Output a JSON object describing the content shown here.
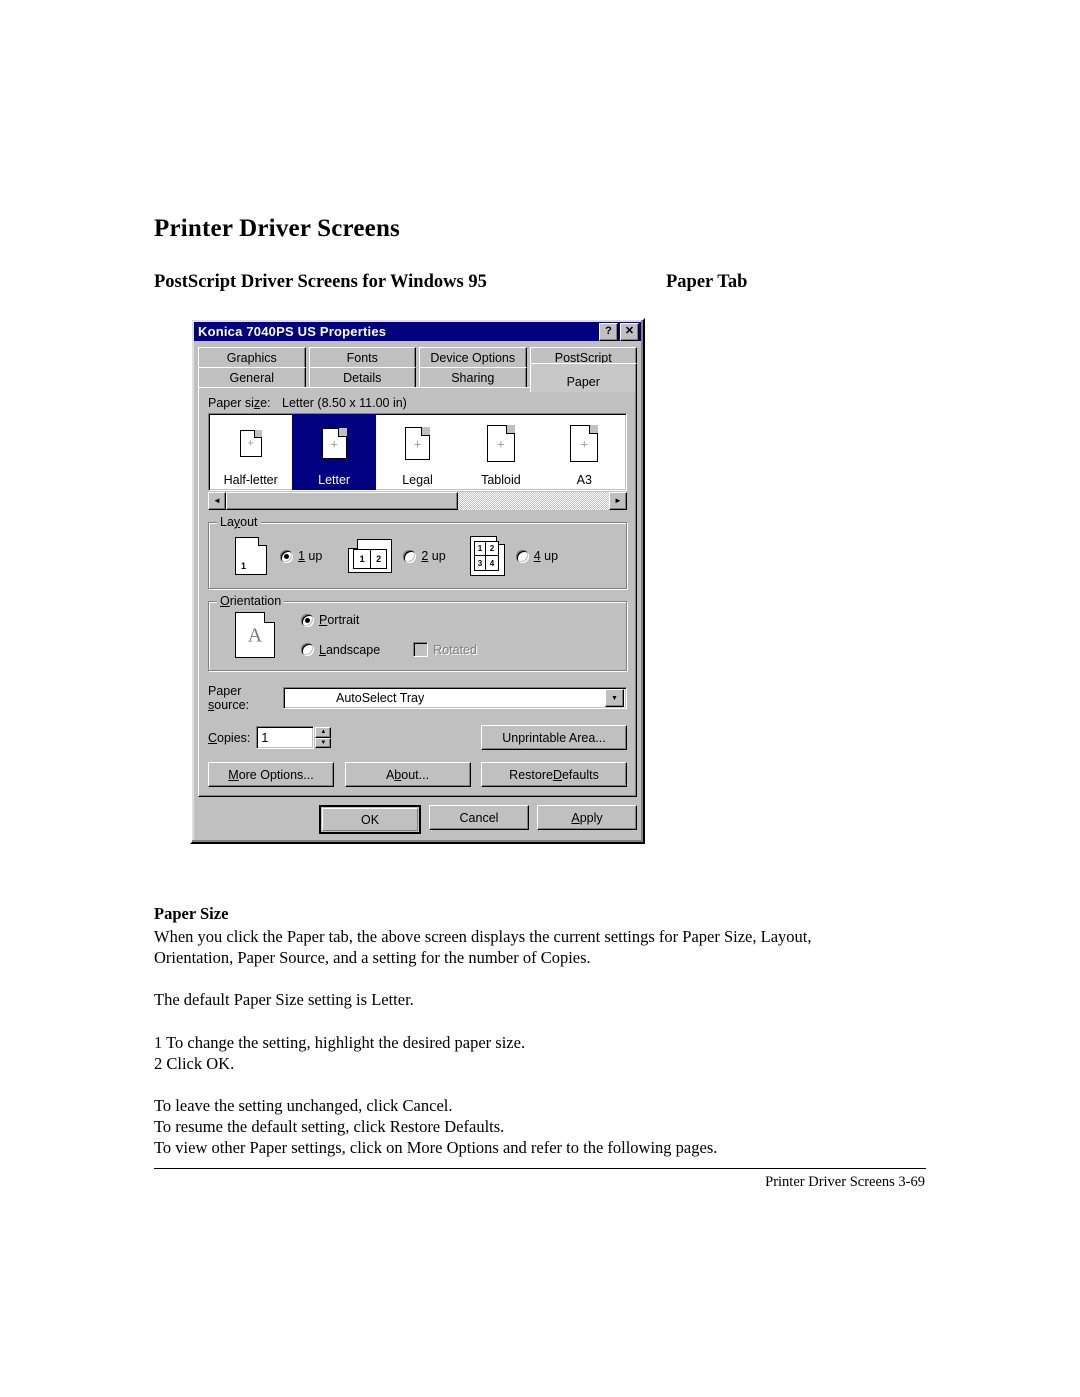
{
  "document": {
    "title": "Printer Driver Screens",
    "subheading": "PostScript Driver Screens for Windows 95",
    "section_label": "Paper Tab",
    "body": {
      "heading": "Paper Size",
      "p1_line1": "When you click the Paper tab, the above screen displays the current settings for Paper Size, Layout,",
      "p1_line2": "Orientation, Paper Source, and a setting for the number of Copies.",
      "p2": "The default Paper Size setting is Letter.",
      "step1": "1 To change the setting, highlight the desired paper size.",
      "step2": "2 Click OK.",
      "p3_line1": "To leave the setting unchanged, click Cancel.",
      "p3_line2": "To resume the default setting, click Restore Defaults.",
      "p3_line3": "To view other Paper settings, click on More Options and refer to the following pages."
    },
    "footer": "Printer Driver Screens 3-69"
  },
  "dialog": {
    "title": "Konica 7040PS US Properties",
    "titlebar_buttons": [
      {
        "name": "help-button",
        "glyph": "?"
      },
      {
        "name": "close-button",
        "glyph": "✕"
      }
    ],
    "tabs_row1": [
      "Graphics",
      "Fonts",
      "Device Options",
      "PostScript"
    ],
    "tabs_row2": [
      "General",
      "Details",
      "Sharing",
      "Paper"
    ],
    "active_tab": "Paper",
    "paper_size": {
      "label": "Paper size:",
      "value": "Letter (8.50 x 11.00 in)",
      "options": [
        "Half-letter",
        "Letter",
        "Legal",
        "Tabloid",
        "A3"
      ],
      "selected": "Letter",
      "scroll_left_glyph": "◄",
      "scroll_right_glyph": "►"
    },
    "layout": {
      "title": "Layout",
      "options": [
        {
          "label": "1 up",
          "selected": true,
          "thumb_numbers": [
            "1"
          ]
        },
        {
          "label": "2 up",
          "selected": false,
          "thumb_numbers": [
            "1",
            "2"
          ]
        },
        {
          "label": "4 up",
          "selected": false,
          "thumb_numbers": [
            "1",
            "2",
            "3",
            "4"
          ]
        }
      ]
    },
    "orientation": {
      "title": "Orientation",
      "thumb_letter": "A",
      "portrait": {
        "label": "Portrait",
        "selected": true
      },
      "landscape": {
        "label": "Landscape",
        "selected": false
      },
      "rotated": {
        "label": "Rotated",
        "checked": false,
        "disabled": true
      }
    },
    "paper_source": {
      "label": "Paper source:",
      "value": "AutoSelect Tray",
      "arrow_glyph": "▼"
    },
    "copies": {
      "label": "Copies:",
      "value": "1",
      "up_glyph": "▲",
      "down_glyph": "▼"
    },
    "buttons": {
      "unprintable_area": "Unprintable Area...",
      "more_options": "More Options...",
      "about": "About...",
      "restore_defaults": "Restore Defaults",
      "ok": "OK",
      "cancel": "Cancel",
      "apply": "Apply"
    }
  },
  "colors": {
    "titlebar": "#000080",
    "selection": "#000080",
    "face": "#c0c0c0",
    "disabled_text": "#808080"
  }
}
